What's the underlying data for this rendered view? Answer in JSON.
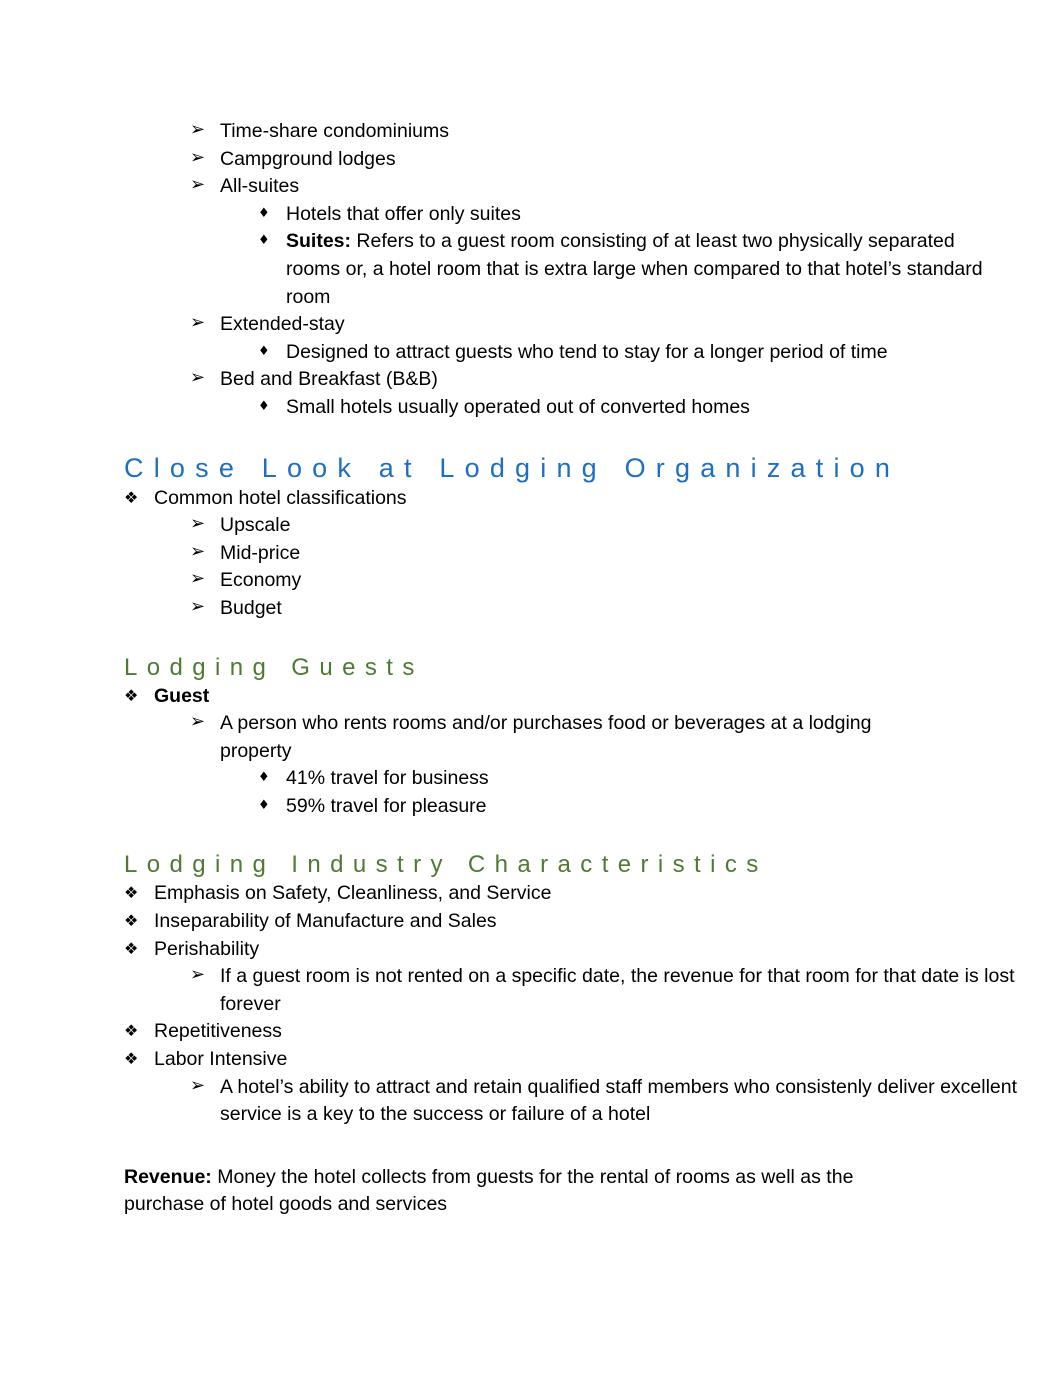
{
  "document": {
    "bullets": {
      "level1": "❖",
      "level2": "➢",
      "level3": "♦"
    },
    "colors": {
      "heading_blue": "#1F6FC0",
      "heading_green": "#4F7A34",
      "body_text": "#000000",
      "page_background": "#FFFFFF"
    },
    "top_list": {
      "items": [
        {
          "label": "Time-share condominiums"
        },
        {
          "label": "Campground lodges"
        },
        {
          "label": "All-suites"
        },
        {
          "label": "Extended-stay"
        },
        {
          "label": "Bed and Breakfast (B&B)"
        }
      ],
      "all_suites_sub": [
        {
          "text": "Hotels that offer only suites"
        }
      ],
      "suites_definition": {
        "term": "Suites:",
        "text": " Refers to a guest room consisting of at least two physically separated rooms or, a hotel room that is extra large when compared to that hotel’s standard room"
      },
      "extended_stay_sub": [
        {
          "text": "Designed to attract guests who tend to stay for a longer period of time"
        }
      ],
      "bnb_sub": [
        {
          "text": "Small hotels usually operated out of converted homes"
        }
      ]
    },
    "section_close_look": {
      "heading": "Close Look at Lodging Organization",
      "intro": "Common hotel classifications",
      "classifications": [
        {
          "label": "Upscale"
        },
        {
          "label": "Mid-price"
        },
        {
          "label": "Economy"
        },
        {
          "label": "Budget"
        }
      ]
    },
    "section_lodging_guests": {
      "heading": "Lodging Guests",
      "term": "Guest",
      "definition": "A person who rents rooms and/or purchases food or beverages at a lodging property",
      "stats": [
        {
          "text": "41% travel for business",
          "value": 41,
          "category": "business"
        },
        {
          "text": "59% travel for pleasure",
          "value": 59,
          "category": "pleasure"
        }
      ]
    },
    "section_industry_characteristics": {
      "heading": "Lodging Industry Characteristics",
      "items": [
        {
          "label": "Emphasis on Safety, Cleanliness, and Service"
        },
        {
          "label": "Inseparability of Manufacture and Sales"
        },
        {
          "label": "Perishability"
        },
        {
          "label": "Repetitiveness"
        },
        {
          "label": "Labor Intensive"
        }
      ],
      "perishability_sub": "If a guest room is not rented on a specific date, the revenue for that room for that date is lost forever",
      "labor_intensive_sub": "A hotel’s ability to attract and retain qualified staff members who consistenly deliver excellent service is a key to the success or failure of a hotel"
    },
    "revenue_note": {
      "term": "Revenue:",
      "text": " Money the hotel collects from guests for the rental of rooms as well as the purchase of hotel goods and services"
    }
  }
}
